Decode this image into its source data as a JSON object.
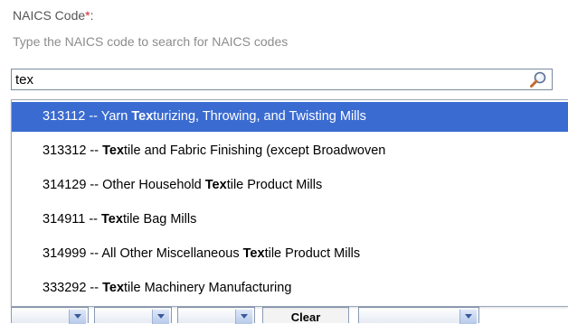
{
  "naics_field": {
    "label": "NAICS Code",
    "required_mark": "*",
    "label_suffix": ":",
    "hint": "Type the NAICS code to search for NAICS codes",
    "search_value": "tex",
    "search_icon": "magnifier-icon"
  },
  "suggestions": [
    {
      "code": "313112",
      "separator": " -- ",
      "before": "Yarn ",
      "match": "Tex",
      "after": "turizing, Throwing, and Twisting Mills",
      "selected": true
    },
    {
      "code": "313312",
      "separator": " -- ",
      "before": "",
      "match": "Tex",
      "after": "tile and Fabric Finishing (except Broadwoven",
      "selected": false
    },
    {
      "code": "314129",
      "separator": " -- ",
      "before": "Other Household ",
      "match": "Tex",
      "after": "tile Product Mills",
      "selected": false
    },
    {
      "code": "314911",
      "separator": " -- ",
      "before": "",
      "match": "Tex",
      "after": "tile Bag Mills",
      "selected": false
    },
    {
      "code": "314999",
      "separator": " -- ",
      "before": "All Other Miscellaneous ",
      "match": "Tex",
      "after": "tile Product Mills",
      "selected": false
    },
    {
      "code": "333292",
      "separator": " -- ",
      "before": "",
      "match": "Tex",
      "after": "tile Machinery Manufacturing",
      "selected": false
    }
  ],
  "bottom_controls": {
    "clear_label": "Clear"
  },
  "colors": {
    "selected_bg": "#3a6bd1",
    "required": "#d9232d",
    "hint": "#8c8c8c"
  }
}
